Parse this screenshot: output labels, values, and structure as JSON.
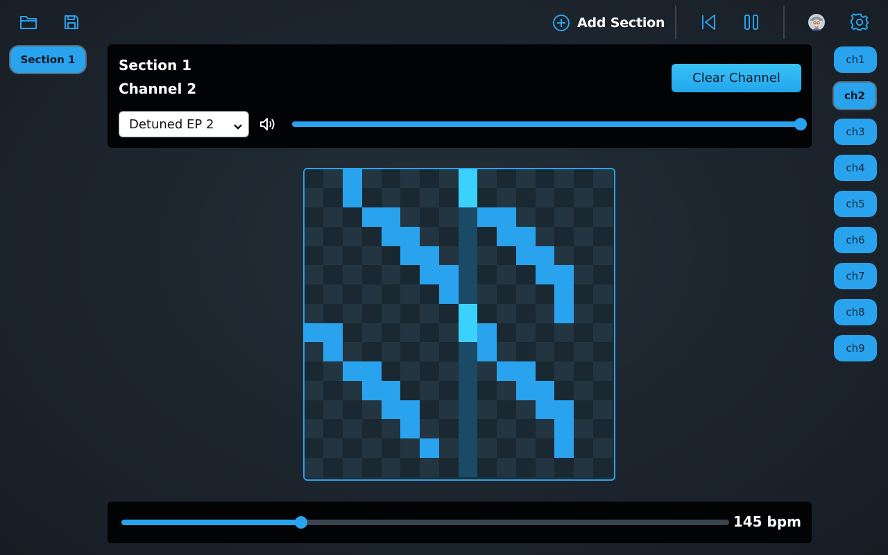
{
  "toolbar": {
    "add_section_label": "Add Section"
  },
  "sections": [
    {
      "label": "Section 1",
      "active": true
    }
  ],
  "panel": {
    "section_title": "Section 1",
    "channel_title": "Channel 2",
    "clear_label": "Clear Channel",
    "instrument_selected": "Detuned EP 2",
    "volume": 1.0
  },
  "channels": [
    {
      "label": "ch1",
      "active": false
    },
    {
      "label": "ch2",
      "active": true
    },
    {
      "label": "ch3",
      "active": false
    },
    {
      "label": "ch4",
      "active": false
    },
    {
      "label": "ch5",
      "active": false
    },
    {
      "label": "ch6",
      "active": false
    },
    {
      "label": "ch7",
      "active": false
    },
    {
      "label": "ch8",
      "active": false
    },
    {
      "label": "ch9",
      "active": false
    }
  ],
  "sequencer": {
    "columns": 16,
    "rows": 16,
    "playhead_column": 8,
    "active_steps": [
      [
        0,
        2
      ],
      [
        1,
        2
      ],
      [
        2,
        3
      ],
      [
        2,
        4
      ],
      [
        3,
        4
      ],
      [
        3,
        5
      ],
      [
        4,
        5
      ],
      [
        4,
        6
      ],
      [
        5,
        6
      ],
      [
        5,
        7
      ],
      [
        6,
        7
      ],
      [
        7,
        8
      ],
      [
        8,
        0
      ],
      [
        8,
        1
      ],
      [
        9,
        1
      ],
      [
        10,
        2
      ],
      [
        10,
        3
      ],
      [
        11,
        3
      ],
      [
        11,
        4
      ],
      [
        12,
        4
      ],
      [
        12,
        5
      ],
      [
        13,
        5
      ],
      [
        14,
        6
      ],
      [
        0,
        8
      ],
      [
        1,
        8
      ],
      [
        2,
        9
      ],
      [
        2,
        10
      ],
      [
        3,
        10
      ],
      [
        3,
        11
      ],
      [
        4,
        11
      ],
      [
        4,
        12
      ],
      [
        5,
        12
      ],
      [
        5,
        13
      ],
      [
        6,
        13
      ],
      [
        7,
        13
      ],
      [
        8,
        8
      ],
      [
        8,
        9
      ],
      [
        9,
        9
      ],
      [
        10,
        10
      ],
      [
        10,
        11
      ],
      [
        11,
        11
      ],
      [
        11,
        12
      ],
      [
        12,
        12
      ],
      [
        12,
        13
      ],
      [
        13,
        13
      ],
      [
        14,
        13
      ]
    ]
  },
  "tempo": {
    "bpm_label": "145 bpm",
    "slider_fraction": 0.296
  },
  "colors": {
    "accent": "#29a3ee",
    "playhead_active": "#3ad1fb",
    "panel_bg": "#020305"
  }
}
